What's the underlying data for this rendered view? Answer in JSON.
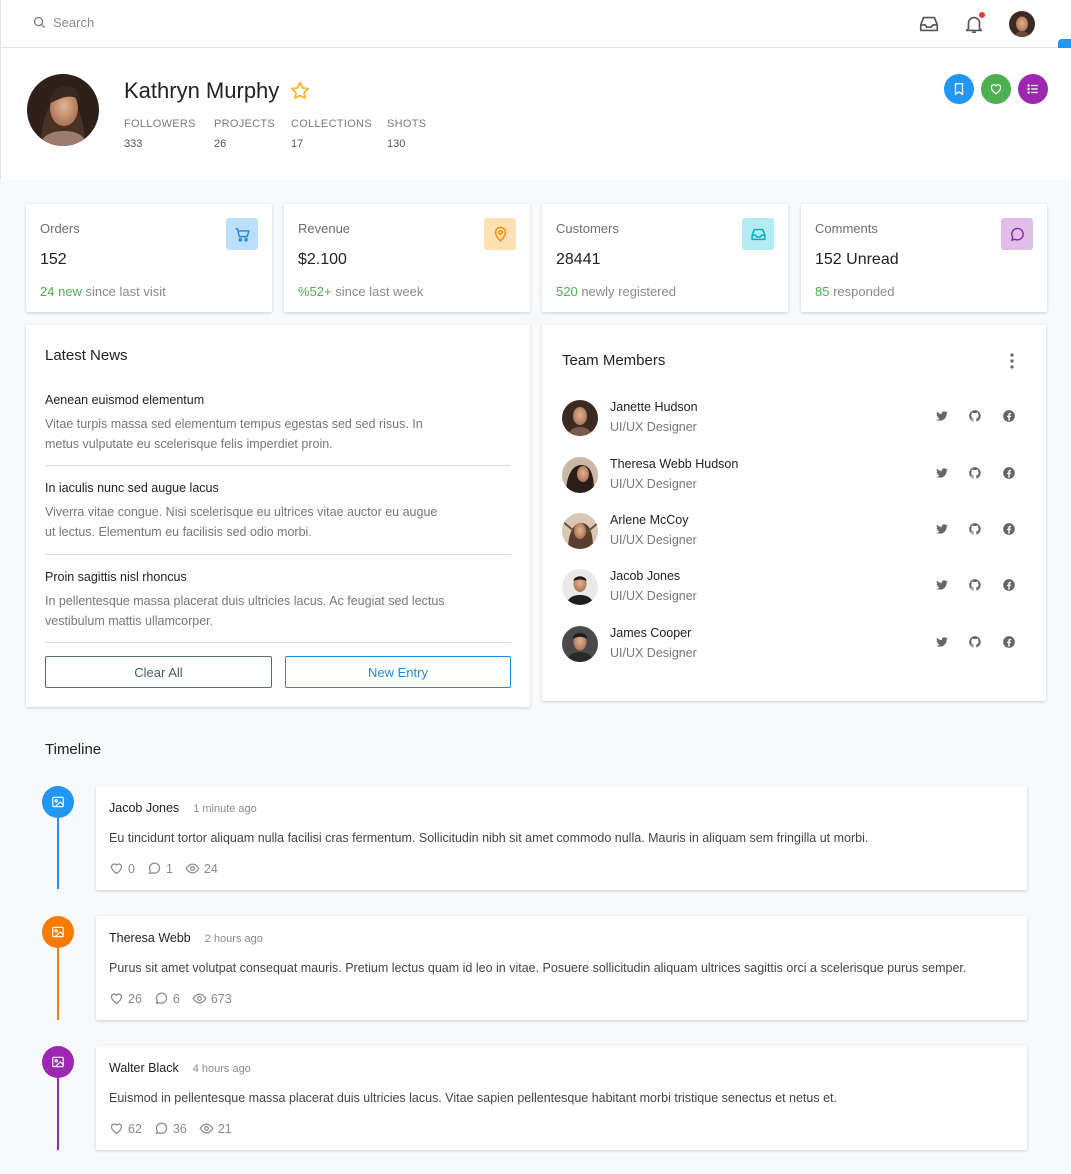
{
  "topbar": {
    "search_placeholder": "Search",
    "icons": [
      "search-icon",
      "inbox-icon",
      "bell-icon"
    ],
    "notification_dot_color": "#e53935"
  },
  "profile": {
    "name": "Kathryn Murphy",
    "favorite_icon": "star-icon",
    "stats": [
      {
        "label": "FOLLOWERS",
        "value": "333"
      },
      {
        "label": "PROJECTS",
        "value": "26"
      },
      {
        "label": "COLLECTIONS",
        "value": "17"
      },
      {
        "label": "SHOTS",
        "value": "130"
      }
    ],
    "actions": [
      {
        "icon": "bookmark-icon",
        "color": "#2196f3"
      },
      {
        "icon": "heart-icon",
        "color": "#4caf50"
      },
      {
        "icon": "list-icon",
        "color": "#9c27b0"
      }
    ]
  },
  "stat_cards": [
    {
      "title": "Orders",
      "value": "152",
      "highlight": "24 new",
      "suffix": " since last visit",
      "icon": "cart-icon",
      "icon_bg": "#bbdefb",
      "icon_color": "#1e88e5"
    },
    {
      "title": "Revenue",
      "value": "$2.100",
      "highlight": "%52+",
      "suffix": " since last week",
      "icon": "map-pin-icon",
      "icon_bg": "#ffe0b2",
      "icon_color": "#fb8c00"
    },
    {
      "title": "Customers",
      "value": "28441",
      "highlight": "520",
      "suffix": " newly registered",
      "icon": "inbox-icon",
      "icon_bg": "#b2ebf2",
      "icon_color": "#00acc1"
    },
    {
      "title": "Comments",
      "value": "152 Unread",
      "highlight": "85",
      "suffix": " responded",
      "icon": "comment-icon",
      "icon_bg": "#e1bee7",
      "icon_color": "#8e24aa"
    }
  ],
  "news": {
    "title": "Latest News",
    "items": [
      {
        "title": "Aenean euismod elementum",
        "text": "Vitae turpis massa sed elementum tempus egestas sed sed risus. In metus vulputate eu scelerisque felis imperdiet proin."
      },
      {
        "title": "In iaculis nunc sed augue lacus",
        "text": "Viverra vitae congue. Nisi scelerisque eu ultrices vitae auctor eu augue ut lectus. Elementum eu facilisis sed odio morbi."
      },
      {
        "title": "Proin sagittis nisl rhoncus",
        "text": "In pellentesque massa placerat duis ultricies lacus. Ac feugiat sed lectus vestibulum mattis ullamcorper."
      }
    ],
    "clear_label": "Clear All",
    "new_label": "New Entry"
  },
  "team": {
    "title": "Team Members",
    "members": [
      {
        "name": "Janette Hudson",
        "role": "UI/UX Designer"
      },
      {
        "name": "Theresa Webb Hudson",
        "role": "UI/UX Designer"
      },
      {
        "name": "Arlene McCoy",
        "role": "UI/UX Designer"
      },
      {
        "name": "Jacob Jones",
        "role": "UI/UX Designer"
      },
      {
        "name": "James Cooper",
        "role": "UI/UX Designer"
      }
    ],
    "social_icons": [
      "twitter-icon",
      "github-icon",
      "facebook-icon"
    ]
  },
  "timeline": {
    "title": "Timeline",
    "entries": [
      {
        "name": "Jacob Jones",
        "time": "1 minute ago",
        "text": "Eu tincidunt tortor aliquam nulla facilisi cras fermentum. Sollicitudin nibh sit amet commodo nulla. Mauris in aliquam sem fringilla ut morbi.",
        "likes": "0",
        "comments": "1",
        "views": "24",
        "color": "#2196f3"
      },
      {
        "name": "Theresa Webb",
        "time": "2 hours ago",
        "text": "Purus sit amet volutpat consequat mauris. Pretium lectus quam id leo in vitae. Posuere sollicitudin aliquam ultrices sagittis orci a scelerisque purus semper.",
        "likes": "26",
        "comments": "6",
        "views": "673",
        "color": "#f57c00"
      },
      {
        "name": "Walter Black",
        "time": "4 hours ago",
        "text": "Euismod in pellentesque massa placerat duis ultricies lacus. Vitae sapien pellentesque habitant morbi tristique senectus et netus et.",
        "likes": "62",
        "comments": "36",
        "views": "21",
        "color": "#9c27b0"
      }
    ]
  }
}
